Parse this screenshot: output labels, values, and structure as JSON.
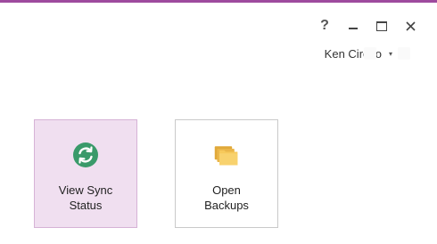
{
  "window": {
    "help_label": "?",
    "controls": [
      "help-icon",
      "minimize-icon",
      "maximize-icon",
      "close-icon"
    ]
  },
  "account": {
    "user_name": "Ken Circeo",
    "caret_symbol": "▾"
  },
  "actions": {
    "sync_label_line1": "View Sync",
    "sync_label_line2": "Status",
    "backups_label_line1": "Open",
    "backups_label_line2": "Backups"
  },
  "colors": {
    "accent": "#9e4a9e",
    "sync_tile_bg": "#f0dff0",
    "sync_icon": "#3a9a6a",
    "folder": "#f6c95b"
  }
}
